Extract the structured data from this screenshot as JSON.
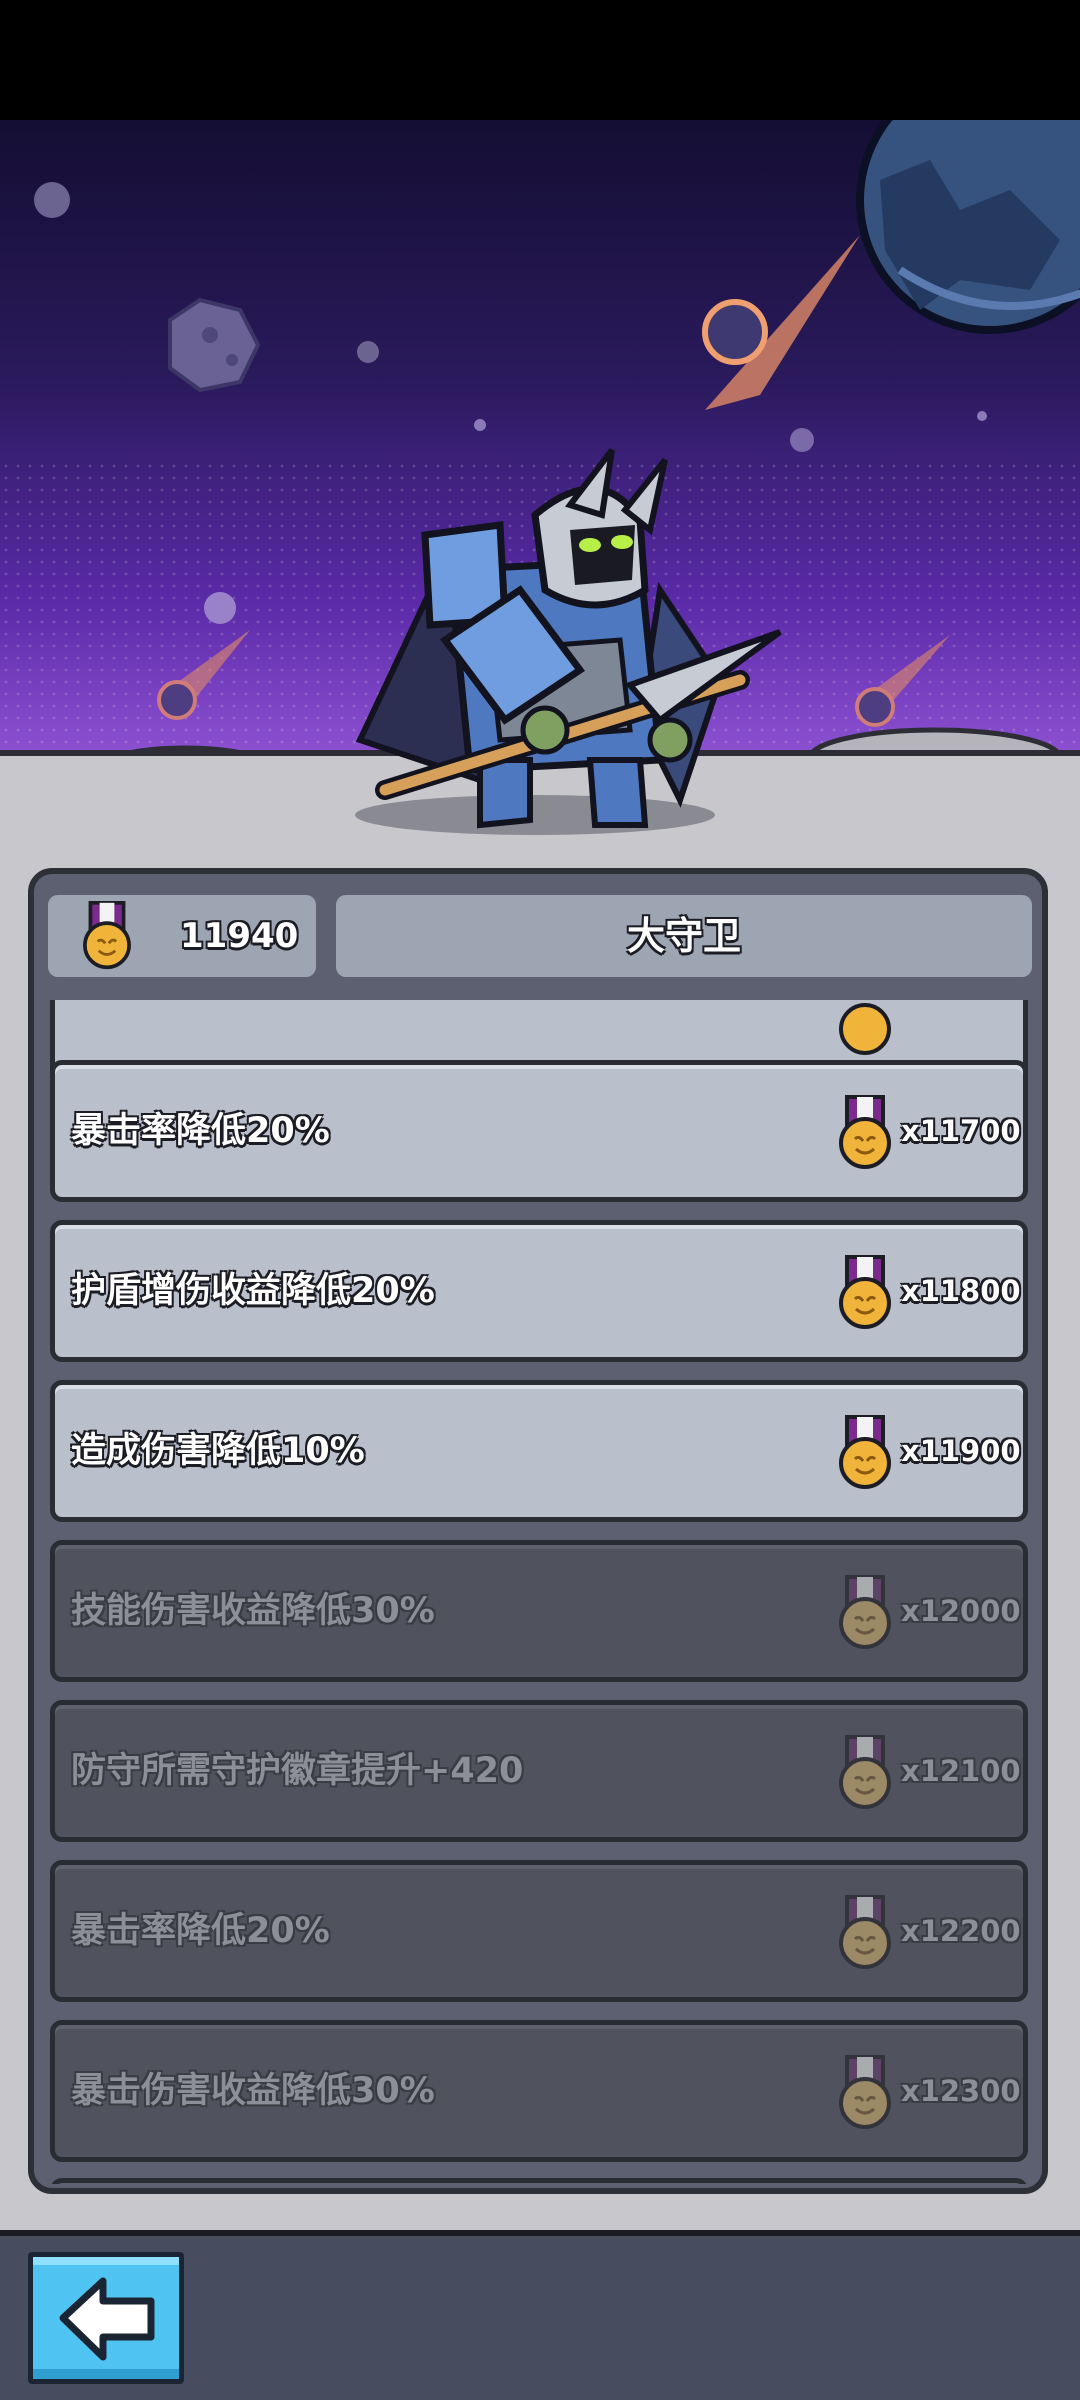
{
  "header": {
    "badge_count": "11940",
    "title": "大守卫"
  },
  "upgrades": [
    {
      "label": "",
      "cost": "",
      "state": "active"
    },
    {
      "label": "暴击率降低20%",
      "cost": "x11700",
      "state": "active"
    },
    {
      "label": "护盾增伤收益降低20%",
      "cost": "x11800",
      "state": "active"
    },
    {
      "label": "造成伤害降低10%",
      "cost": "x11900",
      "state": "active"
    },
    {
      "label": "技能伤害收益降低30%",
      "cost": "x12000",
      "state": "locked"
    },
    {
      "label": "防守所需守护徽章提升+420",
      "cost": "x12100",
      "state": "locked"
    },
    {
      "label": "暴击率降低20%",
      "cost": "x12200",
      "state": "locked"
    },
    {
      "label": "暴击伤害收益降低30%",
      "cost": "x12300",
      "state": "locked"
    }
  ],
  "icons": {
    "medal": "medal-icon",
    "back": "back-arrow-icon"
  },
  "colors": {
    "row_active": "#b9c0cc",
    "row_locked": "#50535d",
    "back_button": "#4fc4f2",
    "medal_ribbon": "#7b2b8c",
    "medal_gold": "#f0b43a"
  }
}
